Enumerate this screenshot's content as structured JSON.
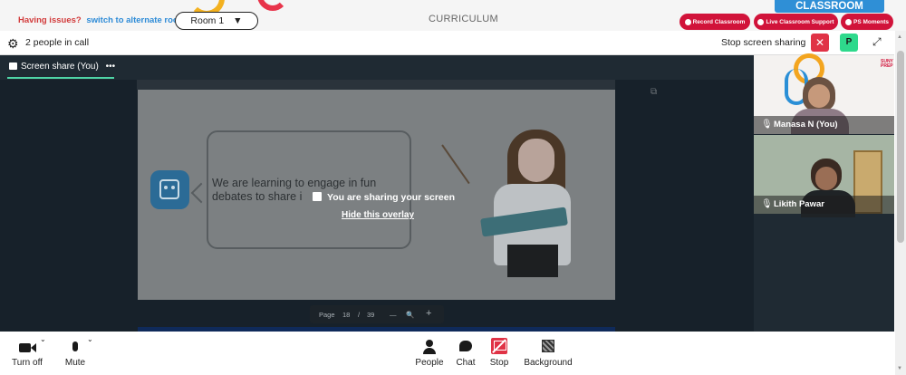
{
  "banner": {
    "issues_question": "Having issues?",
    "issues_link": "switch to alternate room",
    "room_label": "Room 1",
    "room_caret": "▼",
    "curriculum": "CURRICULUM",
    "classroom": "CLASSROOM",
    "pills": [
      {
        "label": "Record Classroom"
      },
      {
        "label": "Live Classroom Support"
      },
      {
        "label": "PS Moments"
      }
    ]
  },
  "call_header": {
    "settings_icon": "gear-icon",
    "people_count": "2 people in call",
    "stop_sharing_label": "Stop screen sharing",
    "stop_icon": "✕",
    "participant_badge": "P",
    "fullscreen_icon": "⤢"
  },
  "screen_share": {
    "tab_label": "Screen share (You)",
    "tab_menu": "•••",
    "slide_text": "We are learning to engage in fun debates to share i",
    "sharing_notice": "You are sharing your screen",
    "hide_overlay": "Hide this overlay",
    "popout_icon": "⧉",
    "pager": {
      "page_label": "Page",
      "current": "18",
      "sep": "/",
      "total": "39",
      "zoom_out": "—",
      "zoom_icon": "🔍",
      "zoom_in": "+"
    }
  },
  "participants": [
    {
      "name": "Manasa N (You)",
      "mic": "🎤"
    },
    {
      "name": "Likith Pawar",
      "mic": "🎤"
    }
  ],
  "tile1_logo": "SUNY\nPREP",
  "controls": {
    "camera": "Turn off",
    "mute": "Mute",
    "people": "People",
    "chat": "Chat",
    "stop": "Stop",
    "background": "Background",
    "caret": "⌄"
  },
  "colors": {
    "accent_red": "#d1133a",
    "accent_green": "#2ed98c",
    "stage_dark": "#1f2a33",
    "link_blue": "#2d8bd7"
  }
}
